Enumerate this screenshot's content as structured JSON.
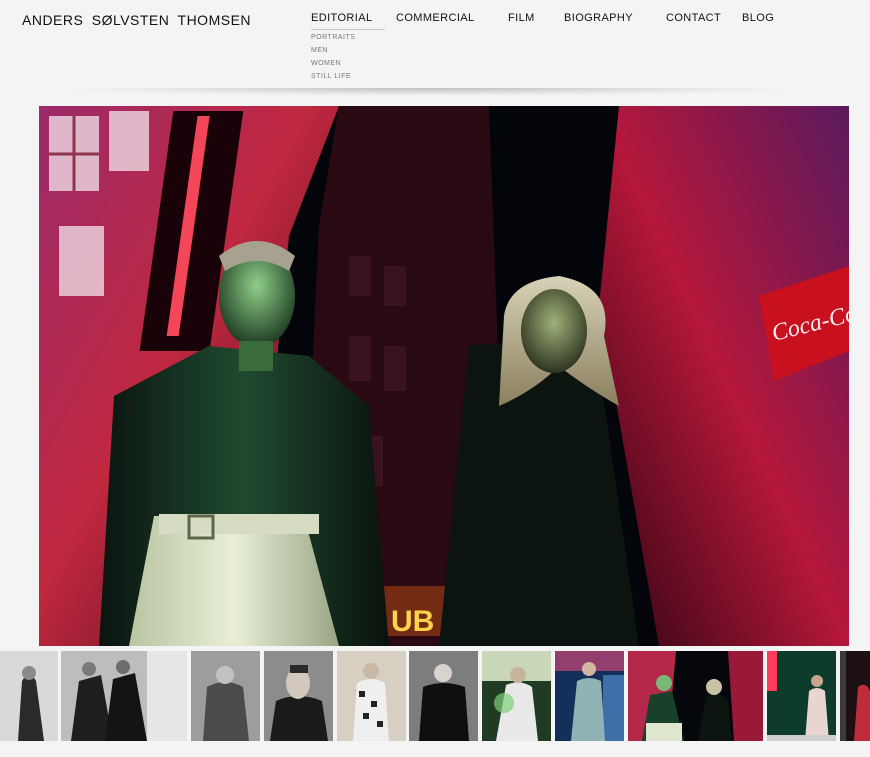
{
  "site": {
    "title": "ANDERS SØLVSTEN THOMSEN"
  },
  "nav": {
    "items": [
      {
        "label": "EDITORIAL",
        "active": true
      },
      {
        "label": "COMMERCIAL",
        "active": false
      },
      {
        "label": "FILM",
        "active": false
      },
      {
        "label": "BIOGRAPHY",
        "active": false
      },
      {
        "label": "CONTACT",
        "active": false
      },
      {
        "label": "BLOG",
        "active": false
      }
    ],
    "subnav": [
      {
        "label": "PORTRAITS"
      },
      {
        "label": "MEN"
      },
      {
        "label": "WOMEN"
      },
      {
        "label": "STILL LIFE"
      }
    ]
  },
  "main_photo": {
    "neon_sign_text": "Coca-Cola",
    "club_sign_text": "UB"
  },
  "thumbnails": {
    "count": 12
  }
}
